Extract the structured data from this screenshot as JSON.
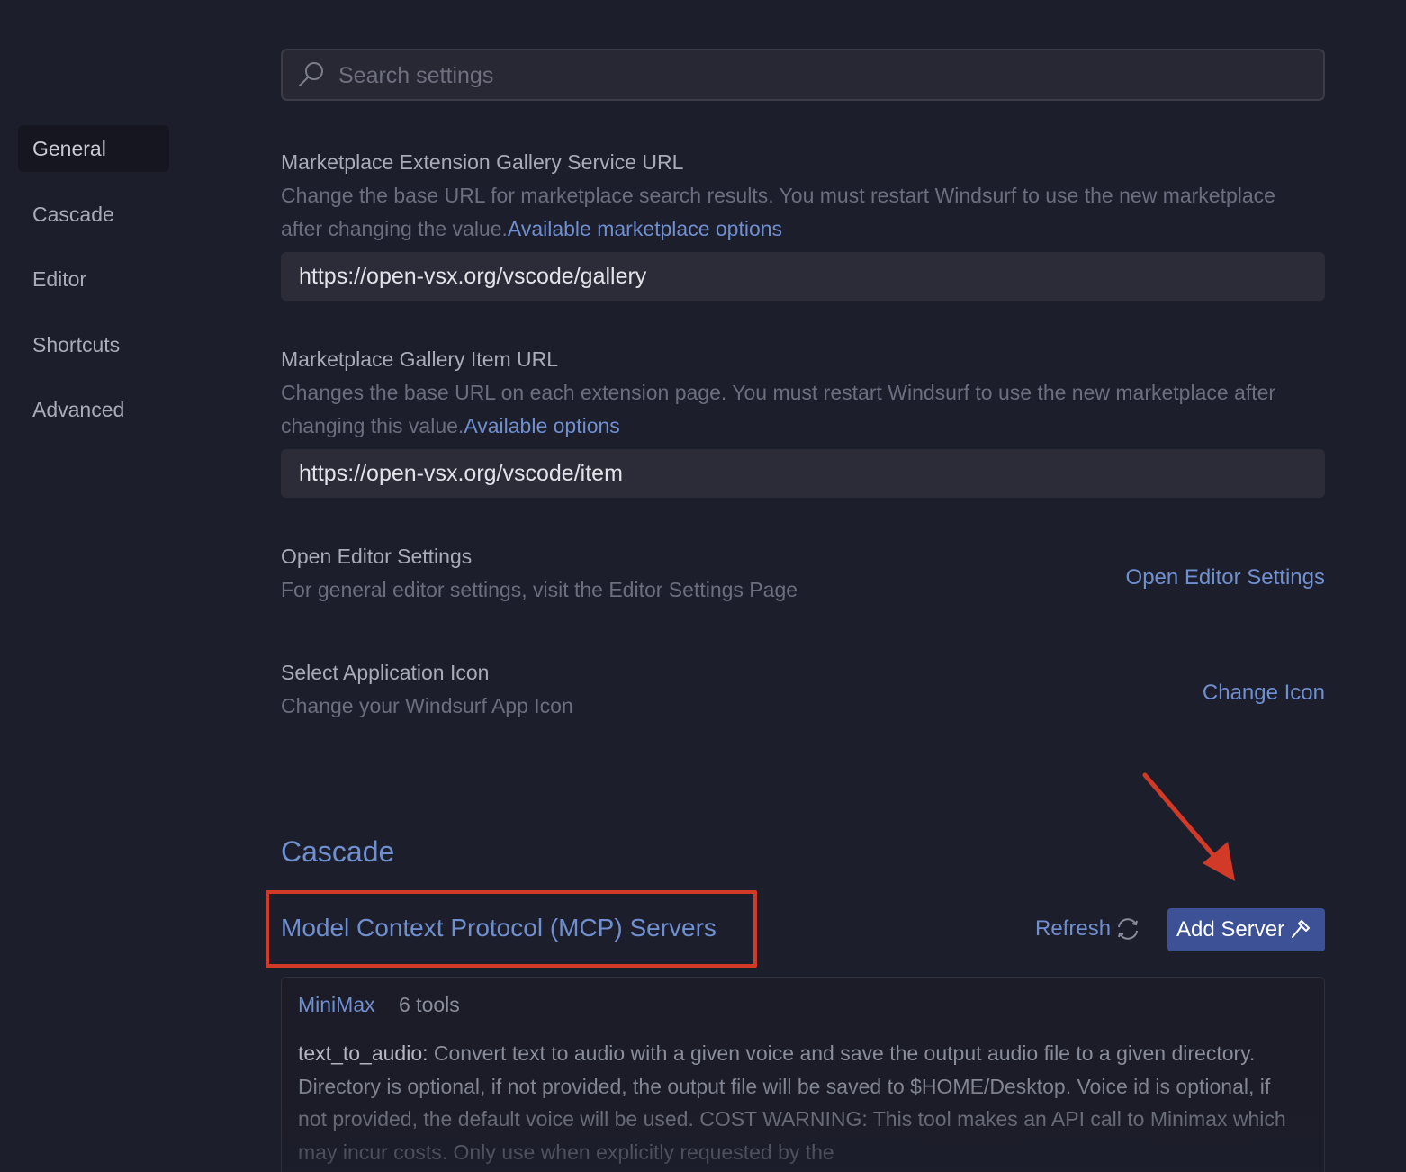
{
  "sidebar": {
    "items": [
      {
        "label": "General",
        "active": true
      },
      {
        "label": "Cascade"
      },
      {
        "label": "Editor"
      },
      {
        "label": "Shortcuts"
      },
      {
        "label": "Advanced"
      }
    ]
  },
  "search": {
    "placeholder": "Search settings",
    "icon": "search-icon"
  },
  "settings": {
    "gallery_service": {
      "title": "Marketplace Extension Gallery Service URL",
      "description": "Change the base URL for marketplace search results. You must restart Windsurf to use the new marketplace after changing the value.",
      "link": "Available marketplace options",
      "value": "https://open-vsx.org/vscode/gallery"
    },
    "gallery_item": {
      "title": "Marketplace Gallery Item URL",
      "description": "Changes the base URL on each extension page. You must restart Windsurf to use the new marketplace after changing this value.",
      "link": "Available options",
      "value": "https://open-vsx.org/vscode/item"
    },
    "editor_settings": {
      "title": "Open Editor Settings",
      "description": "For general editor settings, visit the Editor Settings Page",
      "action": "Open Editor Settings"
    },
    "app_icon": {
      "title": "Select Application Icon",
      "description": "Change your Windsurf App Icon",
      "action": "Change Icon"
    }
  },
  "cascade": {
    "section_title": "Cascade",
    "mcp": {
      "title": "Model Context Protocol (MCP) Servers",
      "refresh_label": "Refresh",
      "add_server_label": "Add Server",
      "servers": [
        {
          "name": "MiniMax",
          "tool_count": "6 tools",
          "tool_name": "text_to_audio:",
          "tool_description": "Convert text to audio with a given voice and save the output audio file to a given directory. Directory is optional, if not provided, the output file will be saved to $HOME/Desktop. Voice id is optional, if not provided, the default voice will be used. COST WARNING: This tool makes an API call to Minimax which may incur costs. Only use when explicitly requested by the"
        }
      ]
    }
  },
  "colors": {
    "background": "#1d1e2b",
    "accent": "#6f8fcf",
    "button": "#3d5196",
    "annotation": "#d23a28"
  }
}
